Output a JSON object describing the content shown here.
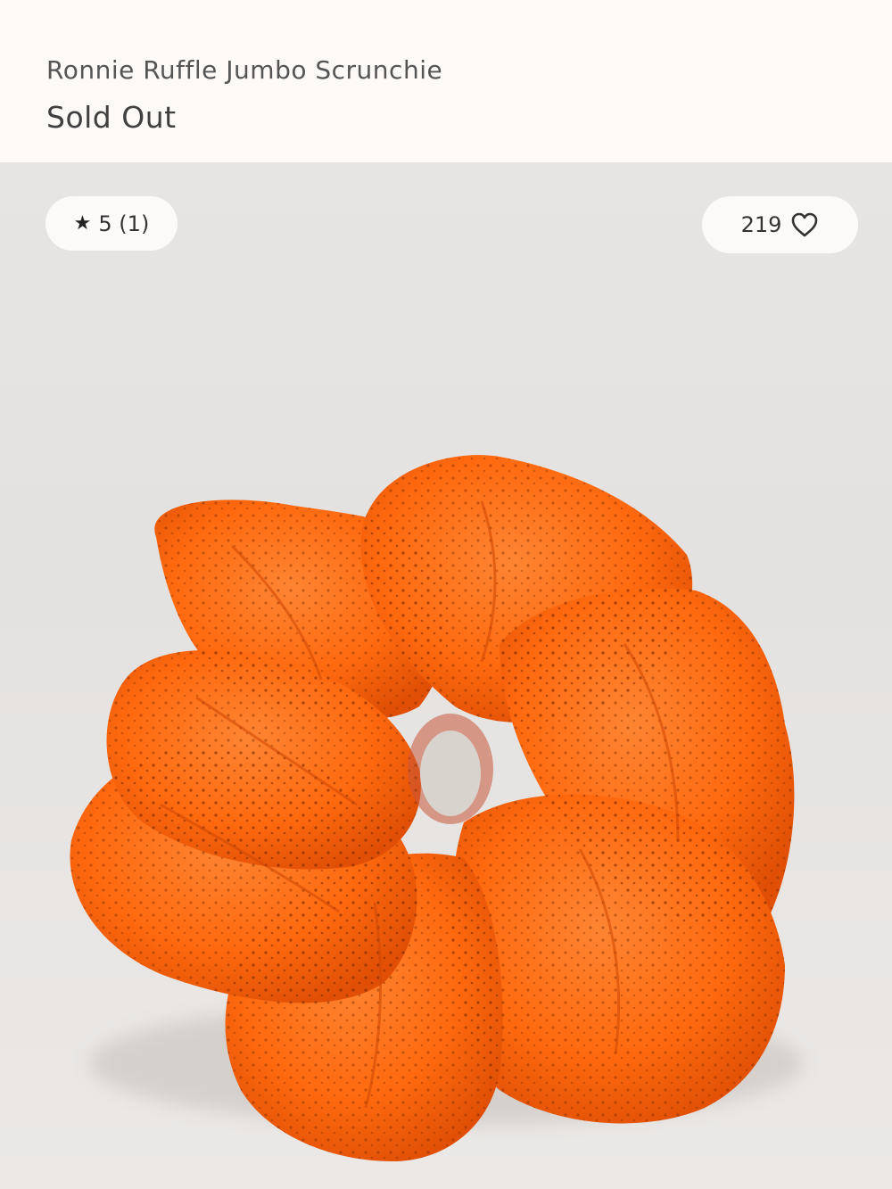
{
  "product": {
    "name": "Ronnie Ruffle Jumbo Scrunchie",
    "price_status": "Sold Out"
  },
  "rating": {
    "icon": "star-icon",
    "text": "5 (1)",
    "value": 5,
    "count": 1
  },
  "likes": {
    "count": "219",
    "icon": "heart-icon"
  },
  "image": {
    "subject": "orange-scrunchie",
    "colors": {
      "scrunchie": "#ff6a0f",
      "scrunchie_shadow": "#e8560a",
      "scrunchie_highlight": "#ff8a3a",
      "background": "#e6e4e2"
    }
  }
}
